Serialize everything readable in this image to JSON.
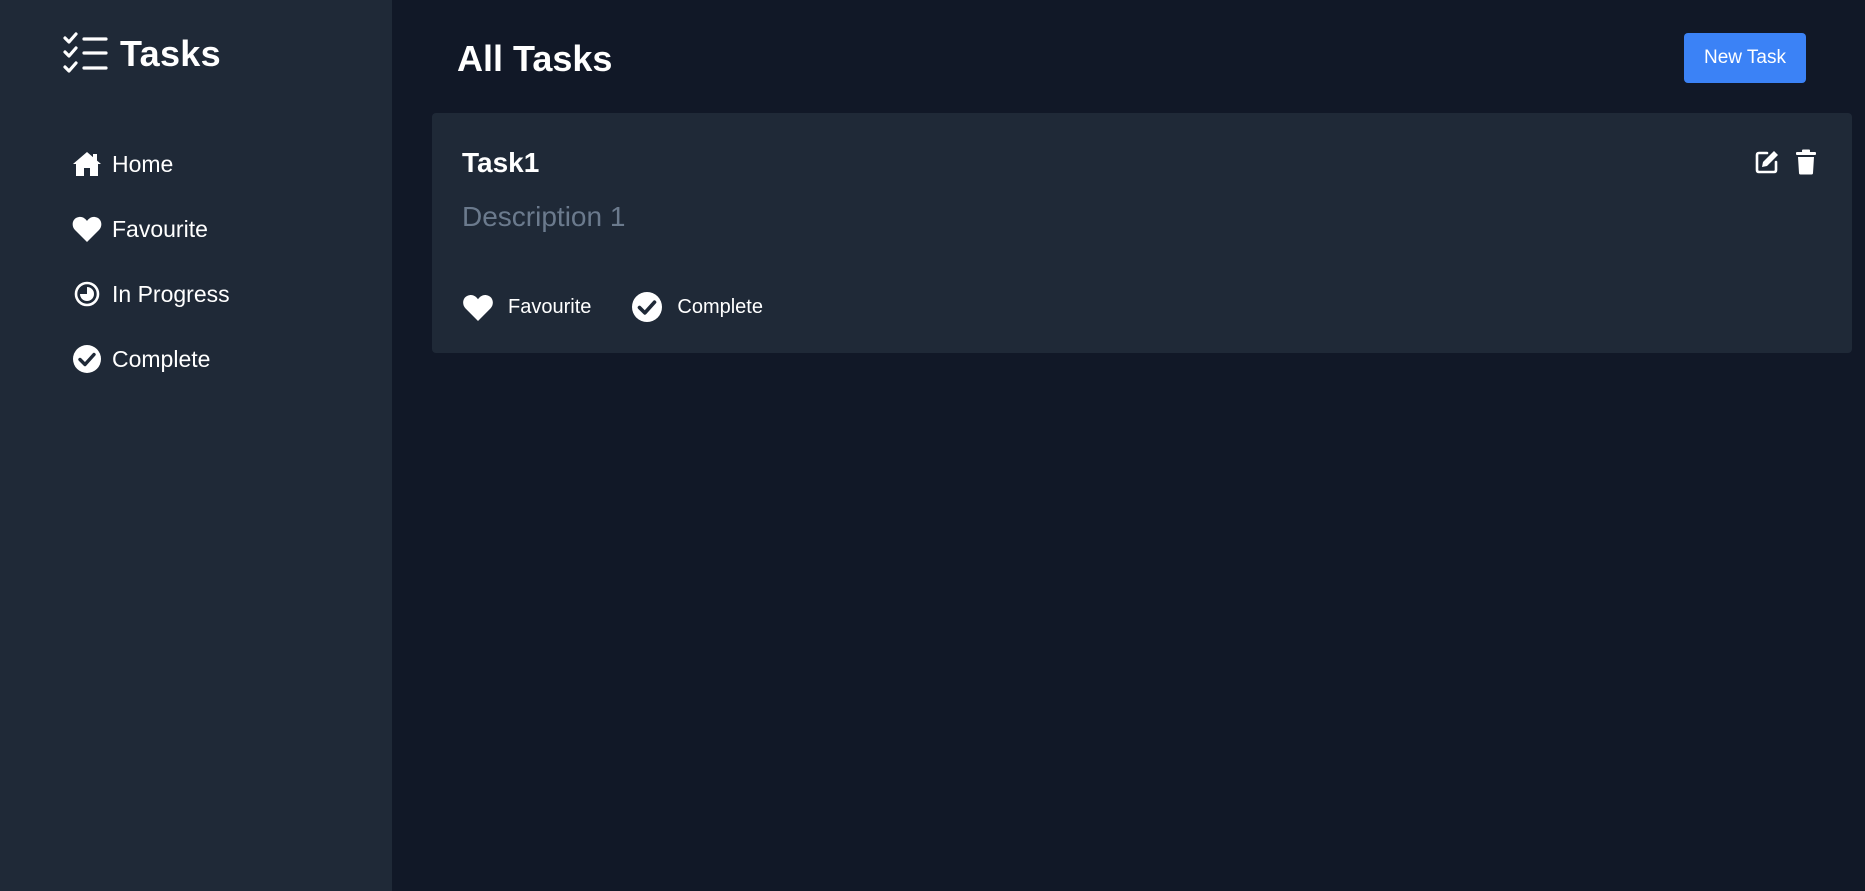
{
  "sidebar": {
    "brand": {
      "title": "Tasks",
      "icon": "tasks-list-icon"
    },
    "items": [
      {
        "label": "Home",
        "icon": "home-icon"
      },
      {
        "label": "Favourite",
        "icon": "heart-icon"
      },
      {
        "label": "In Progress",
        "icon": "in-progress-icon"
      },
      {
        "label": "Complete",
        "icon": "check-circle-icon"
      }
    ]
  },
  "header": {
    "title": "All Tasks",
    "new_task_label": "New Task"
  },
  "tasks": [
    {
      "title": "Task1",
      "description": "Description 1",
      "favourite_label": "Favourite",
      "complete_label": "Complete"
    }
  ],
  "colors": {
    "background": "#111827",
    "sidebar": "#1f2937",
    "card": "#1f2937",
    "accent": "#3b82f6",
    "muted_text": "#6b7a8d"
  }
}
